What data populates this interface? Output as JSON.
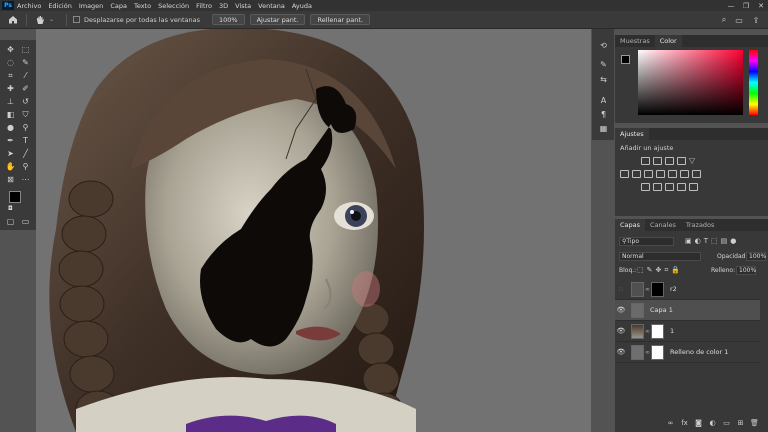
{
  "menubar": {
    "logo": "Ps",
    "items": [
      "Archivo",
      "Edición",
      "Imagen",
      "Capa",
      "Texto",
      "Selección",
      "Filtro",
      "3D",
      "Vista",
      "Ventana",
      "Ayuda"
    ]
  },
  "options": {
    "scroll_all_label": "Desplazarse por todas las ventanas",
    "zoom_value": "100%",
    "fit_screen_label": "Ajustar pant.",
    "fill_screen_label": "Rellenar pant."
  },
  "color_panel": {
    "tabs": [
      "Muestras",
      "Color"
    ],
    "active_tab": "Color",
    "foreground": "#000000",
    "background": "#ffffff",
    "hue_color": "#ff0033"
  },
  "adjustments_panel": {
    "title": "Ajustes",
    "add_label": "Añadir un ajuste"
  },
  "layers_panel": {
    "tabs": [
      "Capas",
      "Canales",
      "Trazados"
    ],
    "active_tab": "Capas",
    "filter_label": "Tipo",
    "blend_mode": "Normal",
    "opacity_label": "Opacidad:",
    "opacity_value": "100%",
    "lock_label": "Bloq.:",
    "fill_label": "Relleno:",
    "fill_value": "100%",
    "layers": [
      {
        "name": "r2",
        "visible": false,
        "selected": false
      },
      {
        "name": "Capa 1",
        "visible": true,
        "selected": true
      },
      {
        "name": "1",
        "visible": true,
        "selected": false
      },
      {
        "name": "Relleno de color 1",
        "visible": true,
        "selected": false
      }
    ]
  },
  "icons": {
    "visibility": "👁",
    "link": "⛓"
  }
}
